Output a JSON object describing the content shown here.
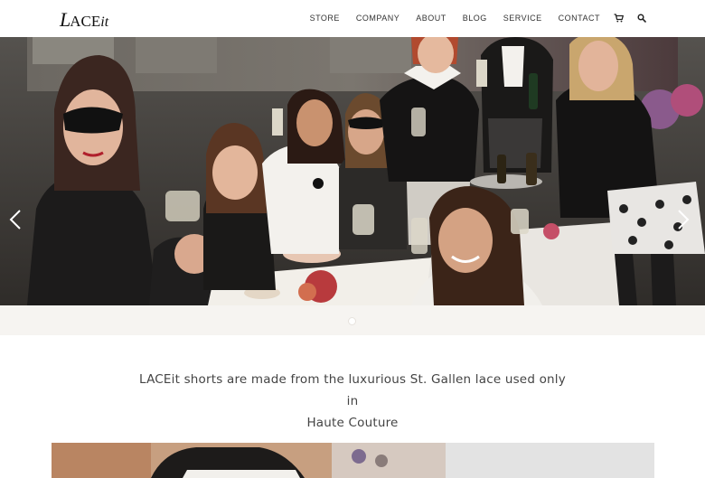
{
  "header": {
    "logo": {
      "part1": "L",
      "part2": "ACE",
      "part3": "it"
    },
    "nav": [
      {
        "label": "STORE"
      },
      {
        "label": "COMPANY"
      },
      {
        "label": "ABOUT"
      },
      {
        "label": "BLOG"
      },
      {
        "label": "SERVICE"
      },
      {
        "label": "CONTACT"
      }
    ],
    "icons": [
      "cart-icon",
      "search-icon"
    ]
  },
  "hero": {
    "slide_count": 1,
    "active_slide": 1,
    "prev_icon": "chevron-left-icon",
    "next_icon": "chevron-right-icon"
  },
  "tagline": {
    "line1": "LACEit shorts are made from the luxurious St. Gallen lace used only in",
    "line2": "Haute Couture"
  },
  "colors": {
    "background": "#ffffff",
    "dots_bar": "#f6f4f1",
    "text": "#333333",
    "grey_panel": "#e3e3e3"
  }
}
